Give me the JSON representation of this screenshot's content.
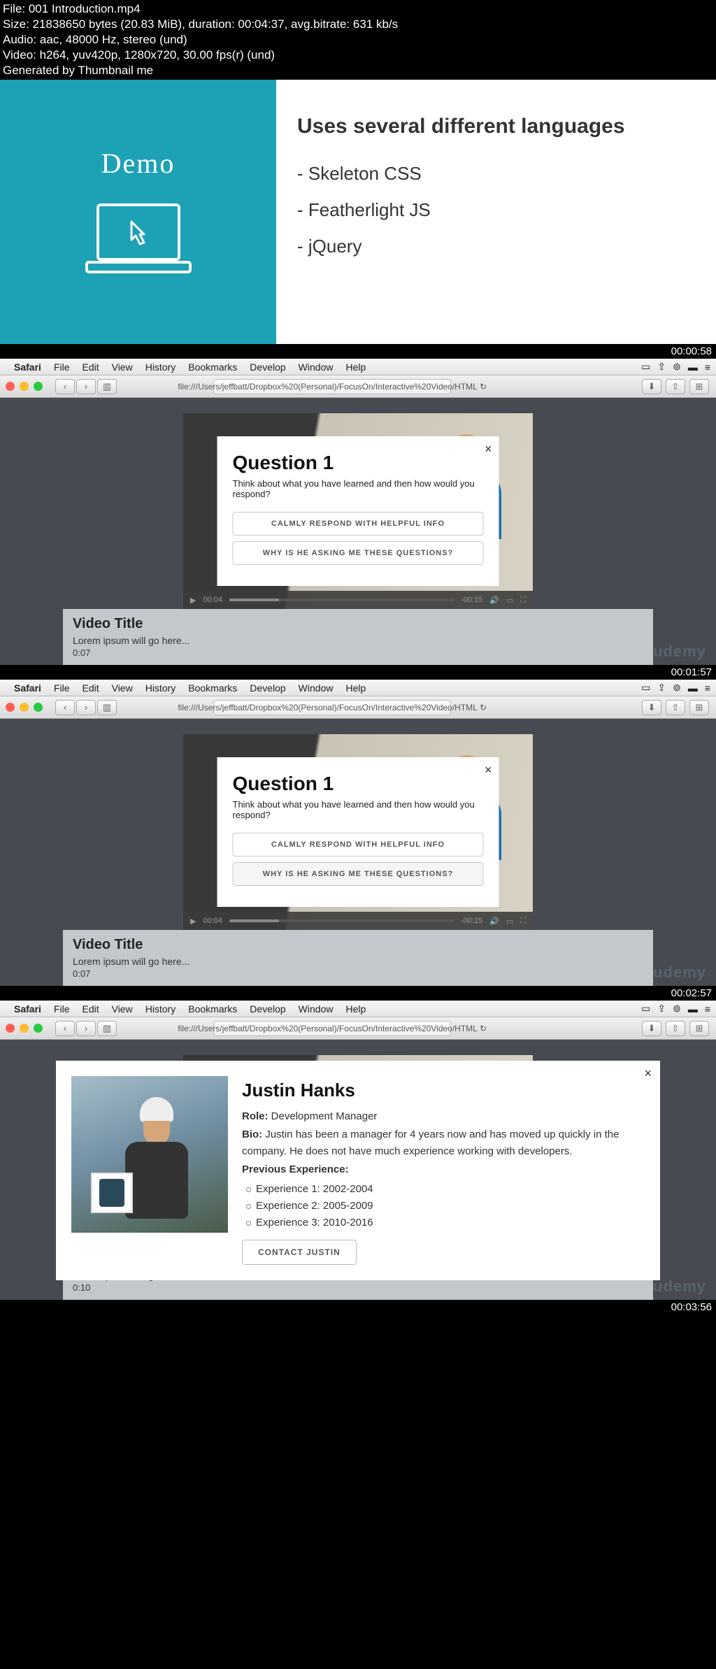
{
  "fileinfo": {
    "line1": "File: 001 Introduction.mp4",
    "line2": "Size: 21838650 bytes (20.83 MiB), duration: 00:04:37, avg.bitrate: 631 kb/s",
    "line3": "Audio: aac, 48000 Hz, stereo (und)",
    "line4": "Video: h264, yuv420p, 1280x720, 30.00 fps(r) (und)",
    "line5": "Generated by Thumbnail me"
  },
  "slide1": {
    "title": "Demo",
    "heading": "Uses several different languages",
    "items": [
      "Skeleton CSS",
      "Featherlight JS",
      "jQuery"
    ],
    "timestamp": "00:00:58"
  },
  "safari": {
    "app": "Safari",
    "menu": [
      "File",
      "Edit",
      "View",
      "History",
      "Bookmarks",
      "Develop",
      "Window",
      "Help"
    ],
    "url": "file:///Users/jeffbatt/Dropbox%20(Personal)/FocusOn/Interactive%20Video/HTML"
  },
  "question": {
    "title": "Question 1",
    "subtitle": "Think about what you have learned and then how would you respond?",
    "option1": "CALMLY RESPOND WITH HELPFUL INFO",
    "option2": "WHY IS HE ASKING ME THESE QUESTIONS?"
  },
  "video_controls": {
    "current": "00:04",
    "remaining": "-00:15"
  },
  "below": {
    "title": "Video Title",
    "desc": "Lorem ipsum will go here...",
    "time1": "0:07",
    "time2": "0:10"
  },
  "timestamps": {
    "t2": "00:01:57",
    "t3": "00:02:57",
    "t4": "00:03:56"
  },
  "watermark": "udemy",
  "profile": {
    "name": "Justin Hanks",
    "role_label": "Role:",
    "role": "Development Manager",
    "bio_label": "Bio:",
    "bio": "Justin has been a manager for 4 years now and has moved up quickly in the company. He does not have much experience working with developers.",
    "prev_label": "Previous Experience:",
    "exp": [
      "Experience 1: 2002-2004",
      "Experience 2: 2005-2009",
      "Experience 3: 2010-2016"
    ],
    "contact": "CONTACT JUSTIN"
  }
}
